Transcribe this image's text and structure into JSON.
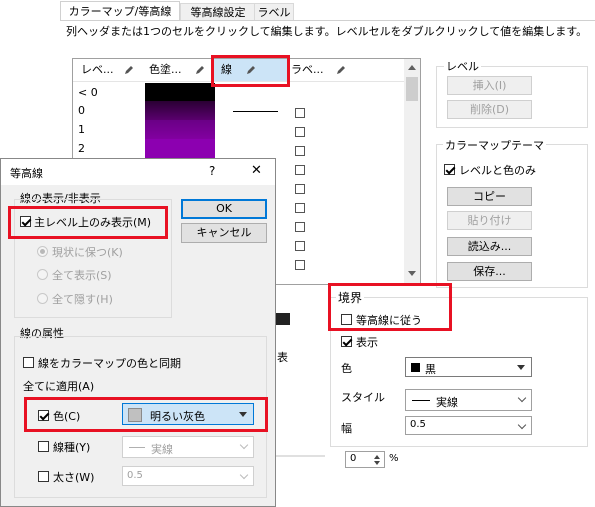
{
  "tabs": [
    "カラーマップ/等高線",
    "等高線設定",
    "ラベル"
  ],
  "instruction": "列ヘッダまたは1つのセルをクリックして編集します。レベルセルをダブルクリックして値を編集します。",
  "grid": {
    "headers": [
      "レベ...",
      "色塗...",
      "線",
      "ラベ..."
    ],
    "levels": [
      "< 0",
      "0",
      "1",
      "2"
    ],
    "fill_colors": [
      "#000000",
      "#5a006e",
      "#8200a0",
      "#8c00b0"
    ]
  },
  "level_group": {
    "title": "レベル",
    "insert": "挿入(I)",
    "delete": "削除(D)"
  },
  "colormap_theme": {
    "title": "カラーマップテーマ",
    "levels_and_colors": "レベルと色のみ",
    "copy": "コピー",
    "paste": "貼り付け",
    "load": "読込み...",
    "save": "保存..."
  },
  "boundary": {
    "title": "境界",
    "follow_contour": "等高線に従う",
    "show": "表示",
    "color_label": "色",
    "color_value": "黒",
    "style_label": "スタイル",
    "style_value": "実線",
    "width_label": "幅",
    "width_value": "0.5"
  },
  "bottom_spinner": {
    "value": "0",
    "unit": "%"
  },
  "dialog": {
    "title": "等高線",
    "help": "?",
    "close": "✕",
    "display_group": "線の表示/非表示",
    "major_only": "主レベル上のみ表示(M)",
    "keep_current": "現状に保つ(K)",
    "show_all": "全て表示(S)",
    "hide_all": "全て隠す(H)",
    "ok": "OK",
    "cancel": "キャンセル",
    "attr_group": "線の属性",
    "sync_colormap": "線をカラーマップの色と同期",
    "apply_all": "全てに適用(A)",
    "color_label": "色(C)",
    "color_value": "明るい灰色",
    "linetype_label": "線種(Y)",
    "linetype_value": "実線",
    "thickness_label": "太さ(W)",
    "thickness_value": "0.5"
  },
  "colors": {
    "selection_red": "#e81123",
    "header_highlight": "#cce4f7",
    "light_gray": "#c0c0c0"
  }
}
